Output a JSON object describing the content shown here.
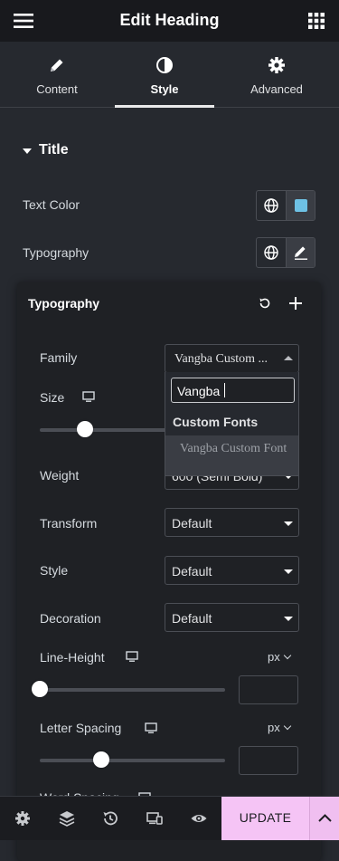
{
  "header": {
    "title": "Edit Heading",
    "menu_icon": "hamburger-icon",
    "apps_icon": "grid-icon"
  },
  "tabs": [
    {
      "label": "Content",
      "icon": "pencil-icon"
    },
    {
      "label": "Style",
      "icon": "contrast-icon",
      "active": true
    },
    {
      "label": "Advanced",
      "icon": "gear-icon"
    }
  ],
  "section": {
    "title": "Title",
    "expanded": true
  },
  "text_color": {
    "label": "Text Color",
    "global_icon": "globe-icon",
    "value": "#6EC1E4"
  },
  "typography_row": {
    "label": "Typography",
    "global_icon": "globe-icon",
    "edit_icon": "pencil-icon"
  },
  "typography": {
    "title": "Typography",
    "reset_icon": "reset-icon",
    "add_icon": "plus-icon",
    "family": {
      "label": "Family",
      "value": "Vangba Custom ..."
    },
    "size": {
      "label": "Size",
      "device_icon": "desktop-icon",
      "slider": 0.37
    },
    "weight": {
      "label": "Weight",
      "value": "600 (Semi Bold)"
    },
    "transform": {
      "label": "Transform",
      "value": "Default"
    },
    "style": {
      "label": "Style",
      "value": "Default"
    },
    "decoration": {
      "label": "Decoration",
      "value": "Default"
    },
    "line_height": {
      "label": "Line-Height",
      "unit": "px",
      "value": "",
      "slider": 0.0
    },
    "letter_spacing": {
      "label": "Letter Spacing",
      "unit": "px",
      "value": "",
      "slider": 0.33
    },
    "word_spacing": {
      "label": "Word Spacing"
    }
  },
  "family_dropdown": {
    "search_value": "Vangba",
    "group_label": "Custom Fonts",
    "option": "Vangba Custom Font"
  },
  "footer": {
    "icons": [
      "settings-icon",
      "layers-icon",
      "history-icon",
      "responsive-icon",
      "preview-icon"
    ],
    "update_label": "UPDATE",
    "colors": {
      "update_bg": "#F5C4F5"
    }
  }
}
